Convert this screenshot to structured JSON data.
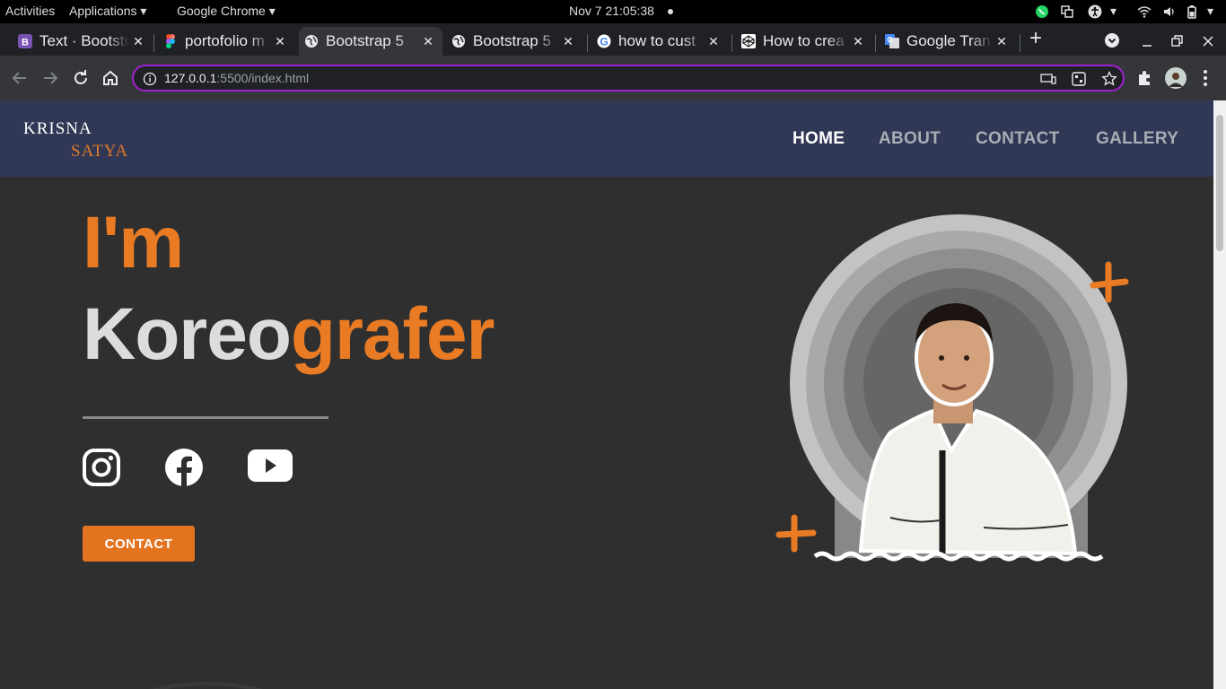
{
  "system": {
    "activities": "Activities",
    "applications": "Applications",
    "app_name": "Google Chrome",
    "clock": "Nov 7  21:05:38"
  },
  "tabs": [
    {
      "title": "Text · Bootstrap",
      "icon": "bootstrap-icon"
    },
    {
      "title": "portofolio m",
      "icon": "figma-icon"
    },
    {
      "title": "Bootstrap 5",
      "icon": "globe-icon",
      "active": true
    },
    {
      "title": "Bootstrap 5",
      "icon": "globe-icon"
    },
    {
      "title": "how to cust",
      "icon": "google-icon"
    },
    {
      "title": "How to crea",
      "icon": "codepen-icon"
    },
    {
      "title": "Google Tran",
      "icon": "google-translate-icon"
    }
  ],
  "address_bar": {
    "host": "127.0.0.1",
    "rest": ":5500/index.html"
  },
  "site": {
    "brand_first": "KRISNA",
    "brand_last": "SATYA",
    "nav": [
      "HOME",
      "ABOUT",
      "CONTACT",
      "GALLERY"
    ],
    "active_nav": "HOME",
    "hero_line1": "I'm",
    "hero_word_a": "Koreo",
    "hero_word_b": "grafer",
    "cta": "CONTACT",
    "socials": [
      "instagram-icon",
      "facebook-icon",
      "youtube-icon"
    ]
  },
  "colors": {
    "accent": "#e97b24",
    "navbar": "#313856",
    "page_bg": "#2f2f2f",
    "omnibox_border": "#a020d0"
  }
}
